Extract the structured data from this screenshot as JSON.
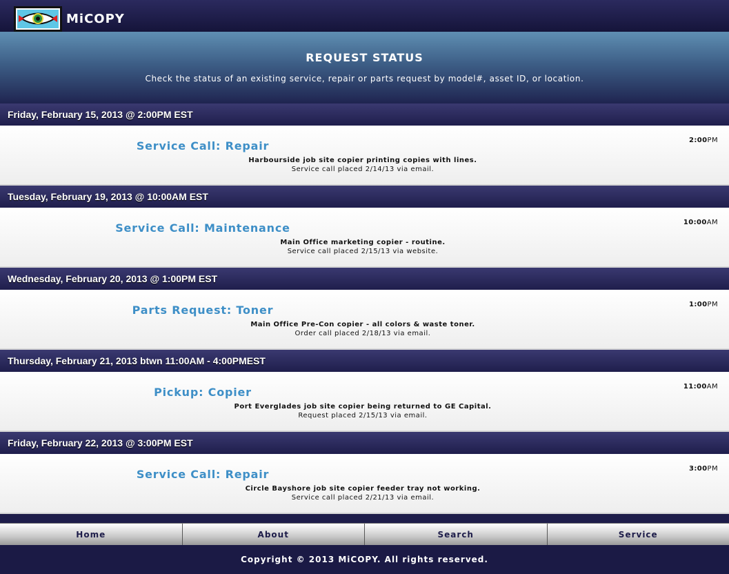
{
  "header": {
    "brand": "MiCOPY",
    "logo_icon": "eye-logo-icon"
  },
  "hero": {
    "title": "REQUEST STATUS",
    "subtitle": "Check the status of an existing service, repair or parts request by model#, asset ID, or location."
  },
  "requests": [
    {
      "date": "Friday, February 15, 2013 @ 2:00PM EST",
      "title": "Service Call: Repair",
      "description": "Harbourside job site copier printing copies with lines.",
      "note": "Service call placed 2/14/13 via email.",
      "time": "2:00",
      "ampm": "PM"
    },
    {
      "date": "Tuesday, February 19, 2013 @ 10:00AM EST",
      "title": "Service Call: Maintenance",
      "description": "Main Office marketing copier - routine.",
      "note": "Service call placed 2/15/13 via website.",
      "time": "10:00",
      "ampm": "AM"
    },
    {
      "date": "Wednesday, February 20, 2013 @ 1:00PM EST",
      "title": "Parts Request: Toner",
      "description": "Main Office Pre-Con copier - all colors & waste toner.",
      "note": "Order call placed 2/18/13 via email.",
      "time": "1:00",
      "ampm": "PM"
    },
    {
      "date": "Thursday, February 21, 2013 btwn 11:00AM - 4:00PMEST",
      "title": "Pickup: Copier",
      "description": "Port Everglades job site copier being returned to GE Capital.",
      "note": "Request placed 2/15/13 via email.",
      "time": "11:00",
      "ampm": "AM"
    },
    {
      "date": "Friday, February 22, 2013 @ 3:00PM EST",
      "title": "Service Call: Repair",
      "description": "Circle Bayshore job site copier feeder tray not working.",
      "note": "Service call placed 2/21/13 via email.",
      "time": "3:00",
      "ampm": "PM"
    }
  ],
  "nav": {
    "home": "Home",
    "about": "About",
    "search": "Search",
    "service": "Service"
  },
  "footer": {
    "copyright": "Copyright © 2013 MiCOPY. All rights reserved."
  }
}
